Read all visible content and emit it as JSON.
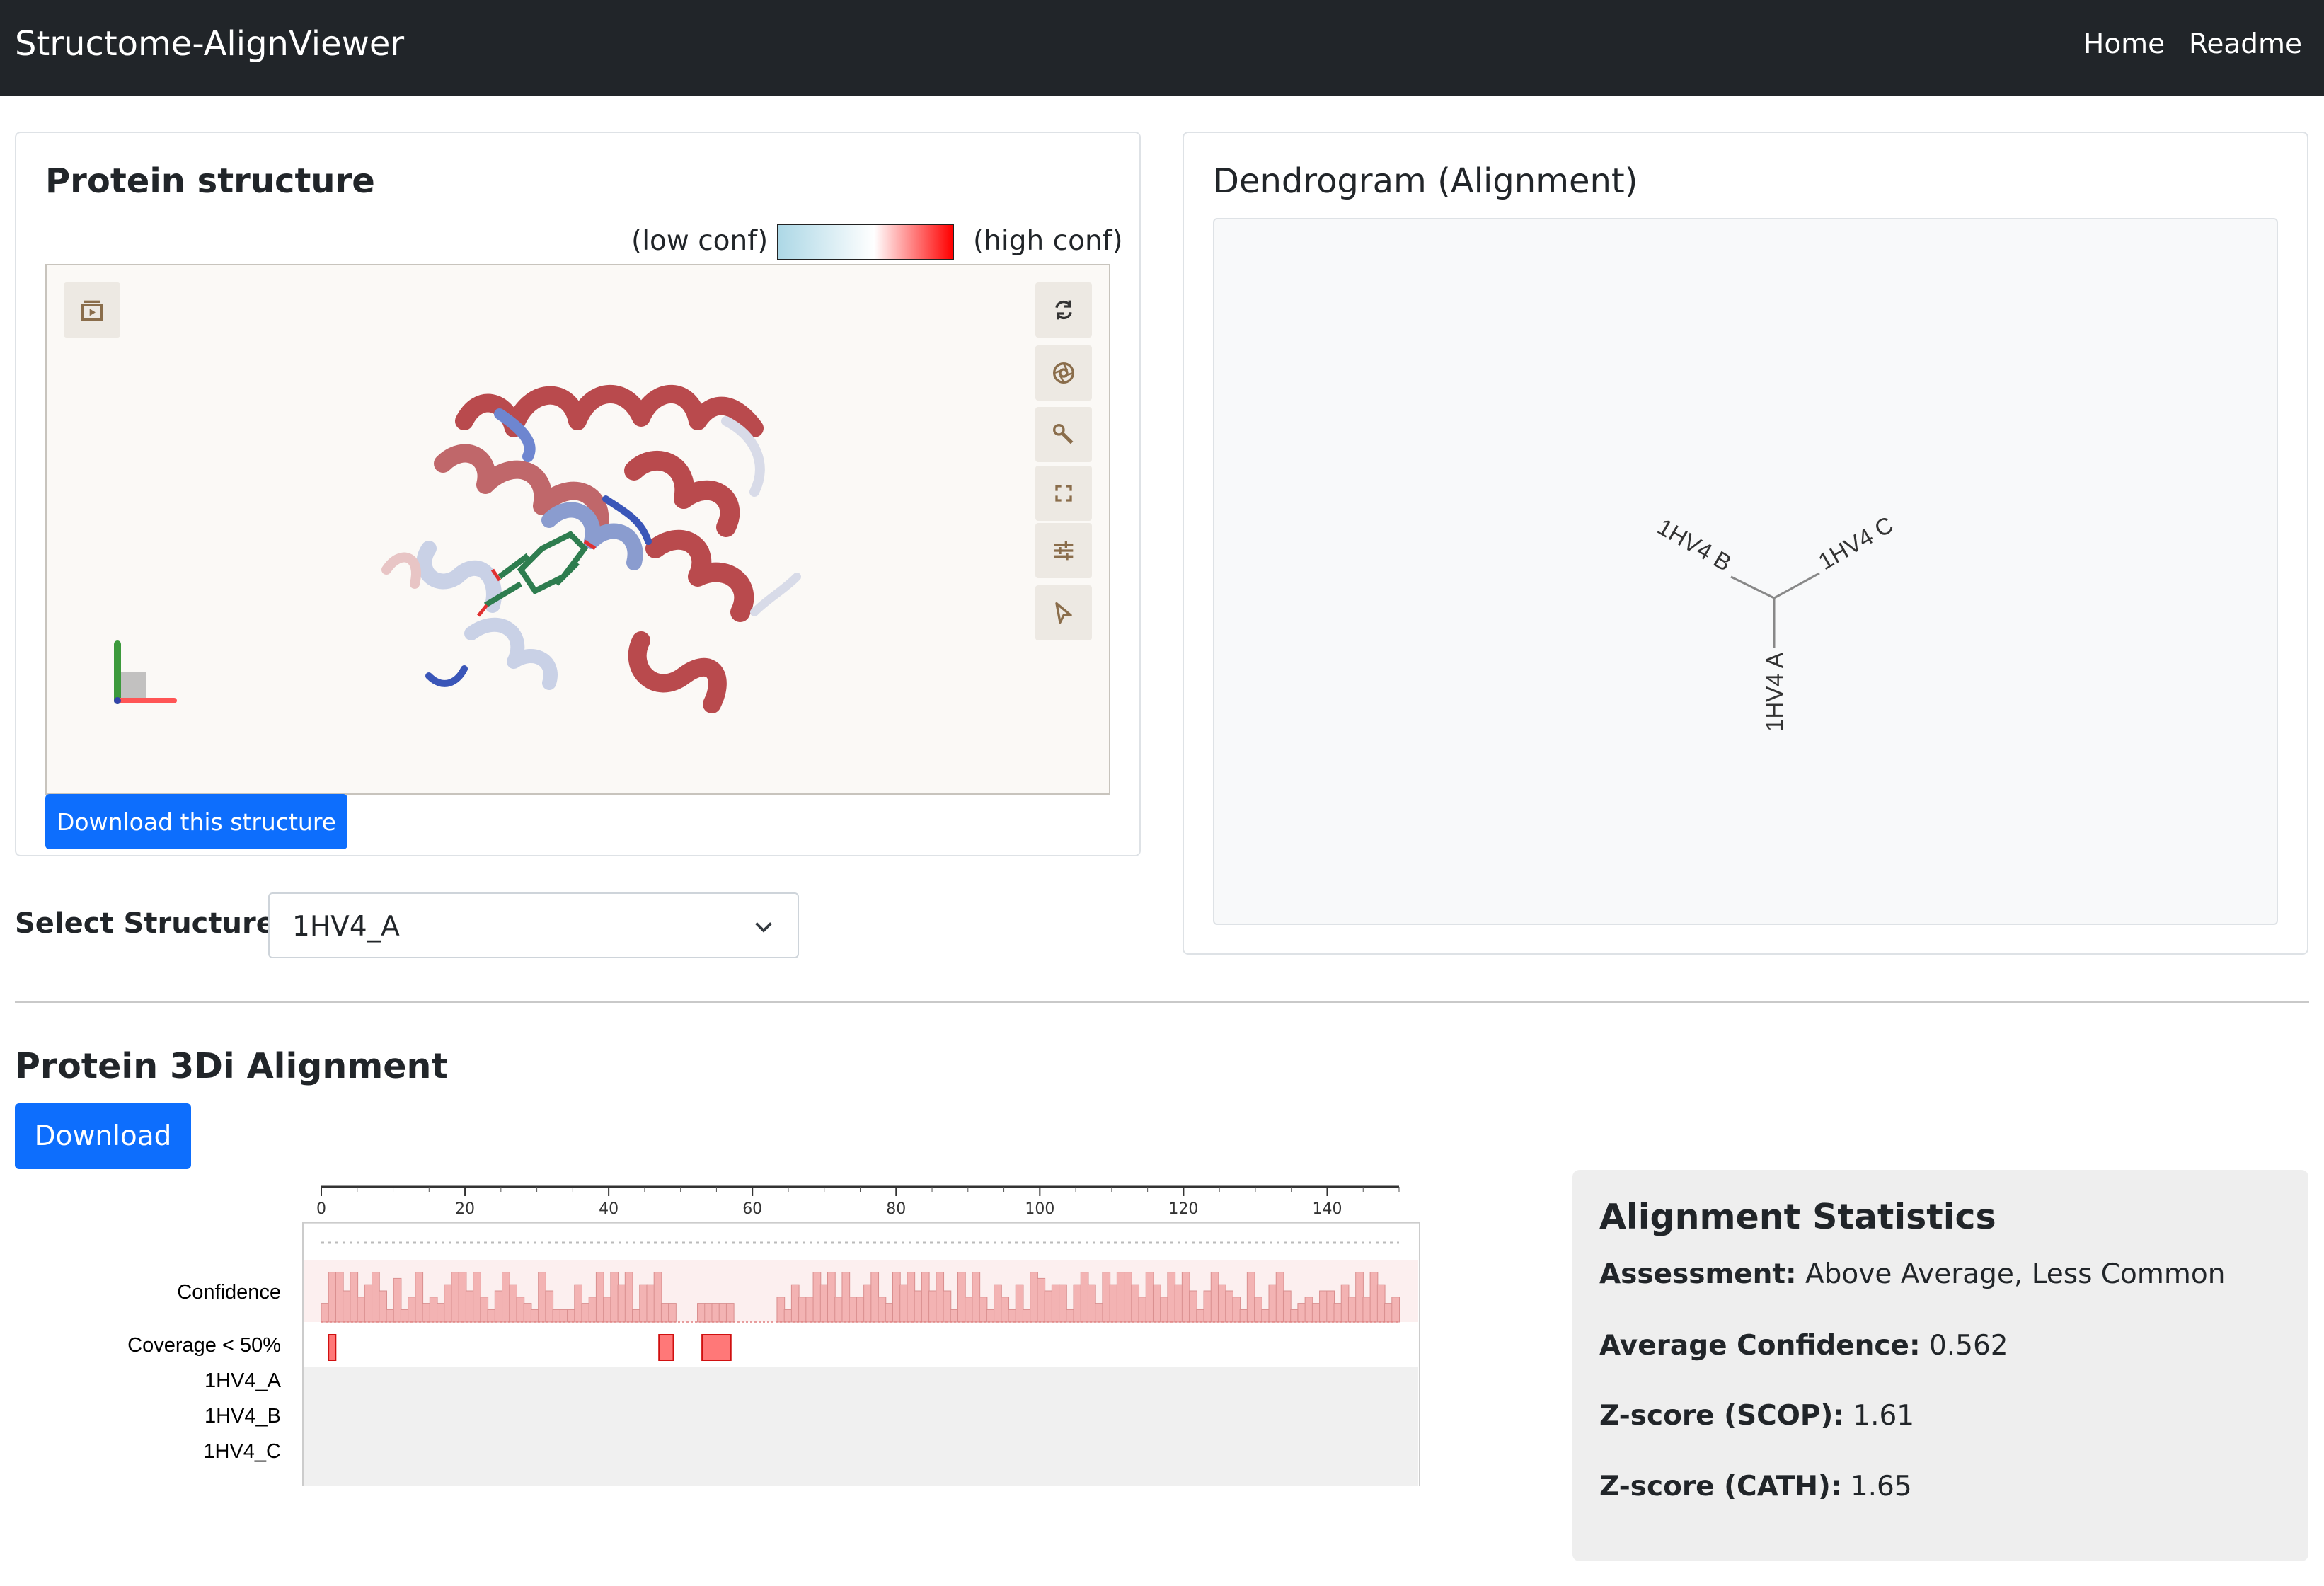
{
  "app": {
    "title": "Structome-AlignViewer"
  },
  "nav": {
    "home": "Home",
    "readme": "Readme"
  },
  "structure_panel": {
    "title": "Protein structure",
    "legend_low": "(low conf)",
    "legend_high": "(high conf)",
    "download_label": "Download this structure",
    "toolbar_icons": [
      "expand-panel-icon",
      "reset-view-icon",
      "screenshot-icon",
      "settings-wrench-icon",
      "fullscreen-icon",
      "controls-sliders-icon",
      "selection-cursor-icon"
    ]
  },
  "select": {
    "label": "Select Structure:",
    "value": "1HV4_A"
  },
  "dendrogram": {
    "title": "Dendrogram (Alignment)",
    "leaves": [
      "1HV4 B",
      "1HV4 C",
      "1HV4 A"
    ]
  },
  "alignment": {
    "title": "Protein 3Di Alignment",
    "download_label": "Download",
    "axis_ticks": [
      "0",
      "20",
      "40",
      "60",
      "80",
      "100",
      "120",
      "140"
    ],
    "row_labels": [
      "Confidence",
      "Coverage < 50%",
      "1HV4_A",
      "1HV4_B",
      "1HV4_C"
    ]
  },
  "chart_data": {
    "type": "bar",
    "title": "",
    "x_range": [
      0,
      150
    ],
    "tick_values": [
      0,
      20,
      40,
      60,
      80,
      100,
      120,
      140
    ],
    "confidence_bars": [
      0.3,
      0.8,
      0.8,
      0.5,
      0.8,
      0.4,
      0.6,
      0.8,
      0.5,
      0.2,
      0.7,
      0.2,
      0.4,
      0.8,
      0.3,
      0.4,
      0.3,
      0.6,
      0.8,
      0.8,
      0.5,
      0.8,
      0.4,
      0.2,
      0.5,
      0.8,
      0.6,
      0.4,
      0.3,
      0.2,
      0.8,
      0.5,
      0.2,
      0.2,
      0.2,
      0.6,
      0.3,
      0.4,
      0.8,
      0.4,
      0.8,
      0.6,
      0.8,
      0.2,
      0.6,
      0.6,
      0.8,
      0.3,
      0.3,
      0.0,
      0.0,
      0.0,
      0.3,
      0.3,
      0.3,
      0.3,
      0.3,
      0.0,
      0.0,
      0.0,
      0.0,
      0.0,
      0.0,
      0.4,
      0.2,
      0.6,
      0.4,
      0.4,
      0.8,
      0.6,
      0.8,
      0.4,
      0.8,
      0.4,
      0.4,
      0.6,
      0.8,
      0.4,
      0.3,
      0.8,
      0.6,
      0.8,
      0.5,
      0.8,
      0.5,
      0.8,
      0.5,
      0.2,
      0.8,
      0.4,
      0.8,
      0.4,
      0.2,
      0.6,
      0.4,
      0.2,
      0.6,
      0.2,
      0.8,
      0.7,
      0.5,
      0.6,
      0.6,
      0.2,
      0.6,
      0.8,
      0.6,
      0.3,
      0.8,
      0.6,
      0.8,
      0.8,
      0.6,
      0.4,
      0.8,
      0.6,
      0.4,
      0.8,
      0.6,
      0.8,
      0.5,
      0.2,
      0.5,
      0.8,
      0.6,
      0.5,
      0.4,
      0.2,
      0.8,
      0.4,
      0.2,
      0.6,
      0.8,
      0.5,
      0.2,
      0.3,
      0.4,
      0.3,
      0.5,
      0.5,
      0.3,
      0.6,
      0.4,
      0.8,
      0.4,
      0.8,
      0.6,
      0.3,
      0.4
    ],
    "coverage_low_ranges": [
      [
        1,
        2
      ],
      [
        47,
        49
      ],
      [
        53,
        57
      ]
    ]
  },
  "stats": {
    "title": "Alignment Statistics",
    "assessment_label": "Assessment:",
    "assessment_value": "Above Average, Less Common",
    "avg_conf_label": "Average Confidence:",
    "avg_conf_value": "0.562",
    "zscore_scop_label": "Z-score (SCOP):",
    "zscore_scop_value": "1.61",
    "zscore_cath_label": "Z-score (CATH):",
    "zscore_cath_value": "1.65"
  },
  "colors": {
    "navbar": "#212529",
    "primary": "#0d6efd",
    "confidence": "#f3b3b3",
    "coverage": "#ff7878"
  }
}
